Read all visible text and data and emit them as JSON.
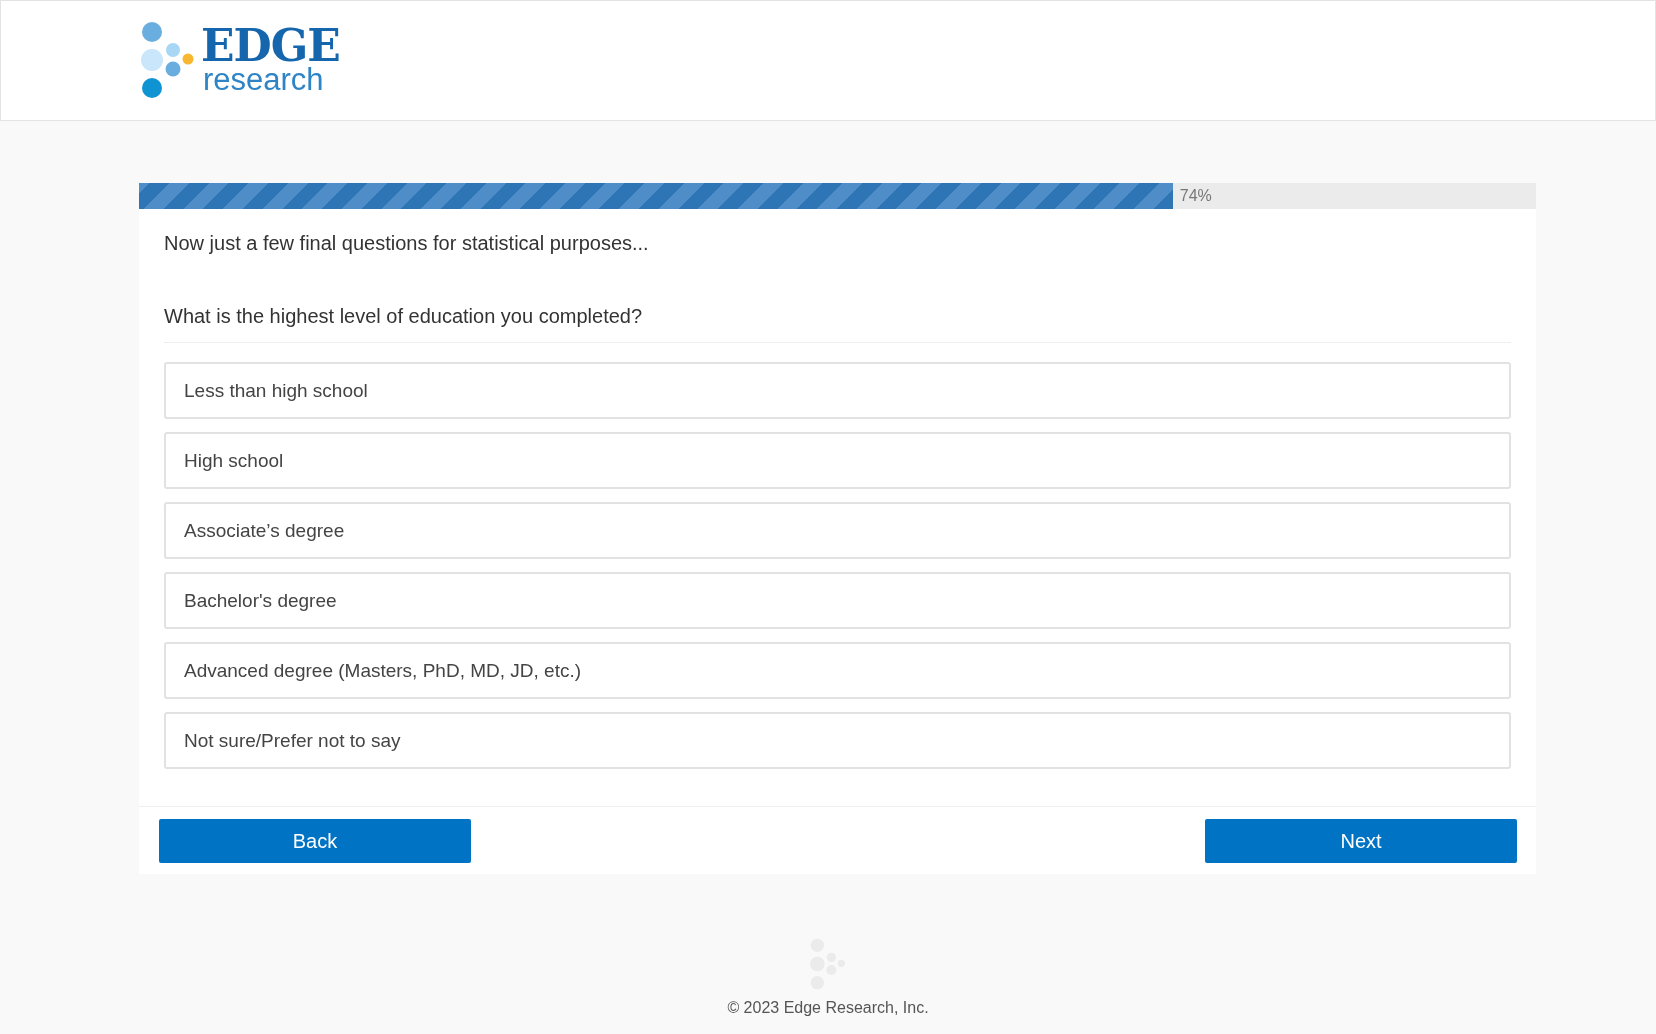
{
  "logo": {
    "line_1": "EDGE",
    "line_2": "research"
  },
  "progress": {
    "level": 0.74,
    "reading": "74%"
  },
  "intro": "Now just a few final questions for statistical purposes...",
  "question": "What is the highest level of education you completed?",
  "options": [
    {
      "label": "Less than high school",
      "selected": false
    },
    {
      "label": "High school",
      "selected": false
    },
    {
      "label": "Associate’s degree",
      "selected": false
    },
    {
      "label": "Bachelor's degree",
      "selected": false
    },
    {
      "label": "Advanced degree (Masters, PhD, MD, JD, etc.)",
      "selected": false
    },
    {
      "label": "Not sure/Prefer not to say",
      "selected": false
    }
  ],
  "buttons": {
    "back": "Back",
    "next": "Next"
  },
  "footer": "© 2023 Edge Research, Inc."
}
